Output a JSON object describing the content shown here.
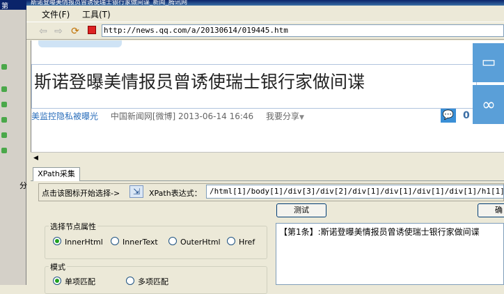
{
  "background_app": {
    "title_fragment": "第",
    "label": "分"
  },
  "window": {
    "title": "斯诺登曝美情报员曾诱使瑞士银行家做间谍_新闻_腾讯网"
  },
  "menu": {
    "file": "文件(F)",
    "tools": "工具(T)"
  },
  "toolbar": {
    "back_icon": "back-arrow-icon",
    "forward_icon": "forward-arrow-icon",
    "refresh_icon": "refresh-icon",
    "stop_icon": "stop-icon",
    "address": "http://news.qq.com/a/20130614/019445.htm"
  },
  "page": {
    "headline": "斯诺登曝美情报员曾诱使瑞士银行家做间谍",
    "meta_link": "美监控隐私被曝光",
    "meta_source": "中国新闻网[微博] 2013-06-14 16:46",
    "meta_share": "我要分享",
    "comment_count": "0"
  },
  "xpath_panel": {
    "tab_label": "XPath采集",
    "pick_label": "点击该图标开始选择->",
    "xpath_label": "XPath表达式：",
    "xpath_value": "/html[1]/body[1]/div[3]/div[2]/div[1]/div[1]/div[1]/div[1]/h1[1]",
    "test_button": "测试",
    "ok_button": "确",
    "node_attr_group": "选择节点属性",
    "attrs": [
      "InnerHtml",
      "InnerText",
      "OuterHtml",
      "Href"
    ],
    "selected_attr": "InnerHtml",
    "mode_group": "模式",
    "modes": [
      "单项匹配",
      "多项匹配"
    ],
    "selected_mode": "单项匹配",
    "result_text": "【第1条】:斯诺登曝美情报员曾诱使瑞士银行家做间谍"
  }
}
